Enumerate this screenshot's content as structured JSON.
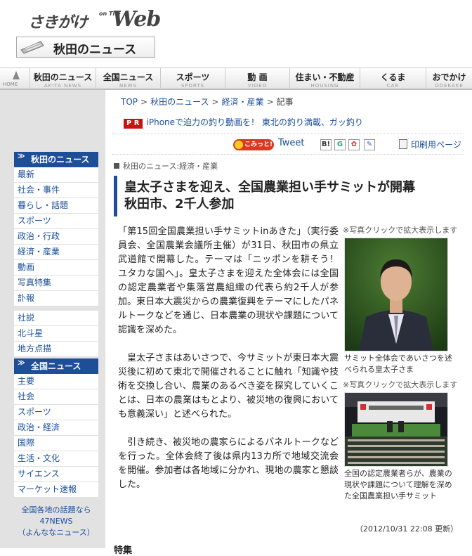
{
  "header": {
    "logo_text": "さきがけ",
    "logo_on_the": "on The",
    "logo_web": "Web",
    "section_title": "秋田のニュース"
  },
  "nav": {
    "home_label": "HOME",
    "items": [
      {
        "jp": "秋田のニュース",
        "en": "AKITA NEWS"
      },
      {
        "jp": "全国ニュース",
        "en": "NEWS"
      },
      {
        "jp": "スポーツ",
        "en": "SPORTS"
      },
      {
        "jp": "動 画",
        "en": "VIDEO"
      },
      {
        "jp": "住まい・不動産",
        "en": "HOUSING"
      },
      {
        "jp": "くるま",
        "en": "CAR"
      },
      {
        "jp": "おでかけ",
        "en": "ODEKAKE"
      }
    ]
  },
  "sidebar": {
    "akita_head": "秋田のニュース",
    "akita_items": [
      "最新",
      "社会・事件",
      "暮らし・話題",
      "スポーツ",
      "政治・行政",
      "経済・産業",
      "動画",
      "写真特集",
      "訃報"
    ],
    "misc_items": [
      "社説",
      "北斗星",
      "地方点描"
    ],
    "zenkoku_head": "全国ニュース",
    "zenkoku_items": [
      "主要",
      "社会",
      "スポーツ",
      "政治・経済",
      "国際",
      "生活・文化",
      "サイエンス",
      "マーケット速報"
    ],
    "news47_line1": "全国各地の話題なら",
    "news47_line2": "47NEWS",
    "news47_line3": "（よんななニュース）"
  },
  "breadcrumb": [
    "TOP",
    "秋田のニュース",
    "経済・産業",
    "記事"
  ],
  "pr": {
    "badge": "P R",
    "text": "iPhoneで迫力の釣り動画を！ 東北の釣り満載、ガッ釣り"
  },
  "share": {
    "komitto": "こみっと!",
    "tweet": "Tweet",
    "print": "印刷用ページ"
  },
  "article": {
    "category": "秋田のニュース:経済・産業",
    "headline_line1": "皇太子さまを迎え、全国農業担い手サミットが開幕",
    "headline_line2": "秋田市、2千人参加",
    "paragraphs": [
      "「第15回全国農業担い手サミットinあきた」（実行委員会、全国農業会議所主催）が31日、秋田市の県立武道館で開幕した。テーマは「ニッポンを耕そう！　ユタカな国へ」。皇太子さまを迎えた全体会には全国の認定農業者や集落営農組織の代表ら約2千人が参加。東日本大震災からの農業復興をテーマにしたパネルトークなどを通じ、日本農業の現状や課題について認識を深めた。",
      "皇太子さまはあいさつで、今サミットが東日本大震災後に初めて東北で開催されることに触れ「知識や技術を交換し合い、農業のあるべき姿を探究していくことは、日本の農業はもとより、被災地の復興においても意義深い」と述べられた。",
      "引き続き、被災地の農家らによるパネルトークなどを行った。全体会終了後は県内13カ所で地域交流会を開催。参加者は各地域に分かれ、現地の農家と懇談した。"
    ],
    "photo_note": "※写真クリックで拡大表示します",
    "photo1_caption": "サミット全体会であいさつを述べられる皇太子さま",
    "photo2_caption": "全国の認定農業者らが、農業の現状や課題について理解を深めた全国農業担い手サミット",
    "updated": "（2012/10/31 22:08 更新）",
    "next_section": "特集"
  }
}
